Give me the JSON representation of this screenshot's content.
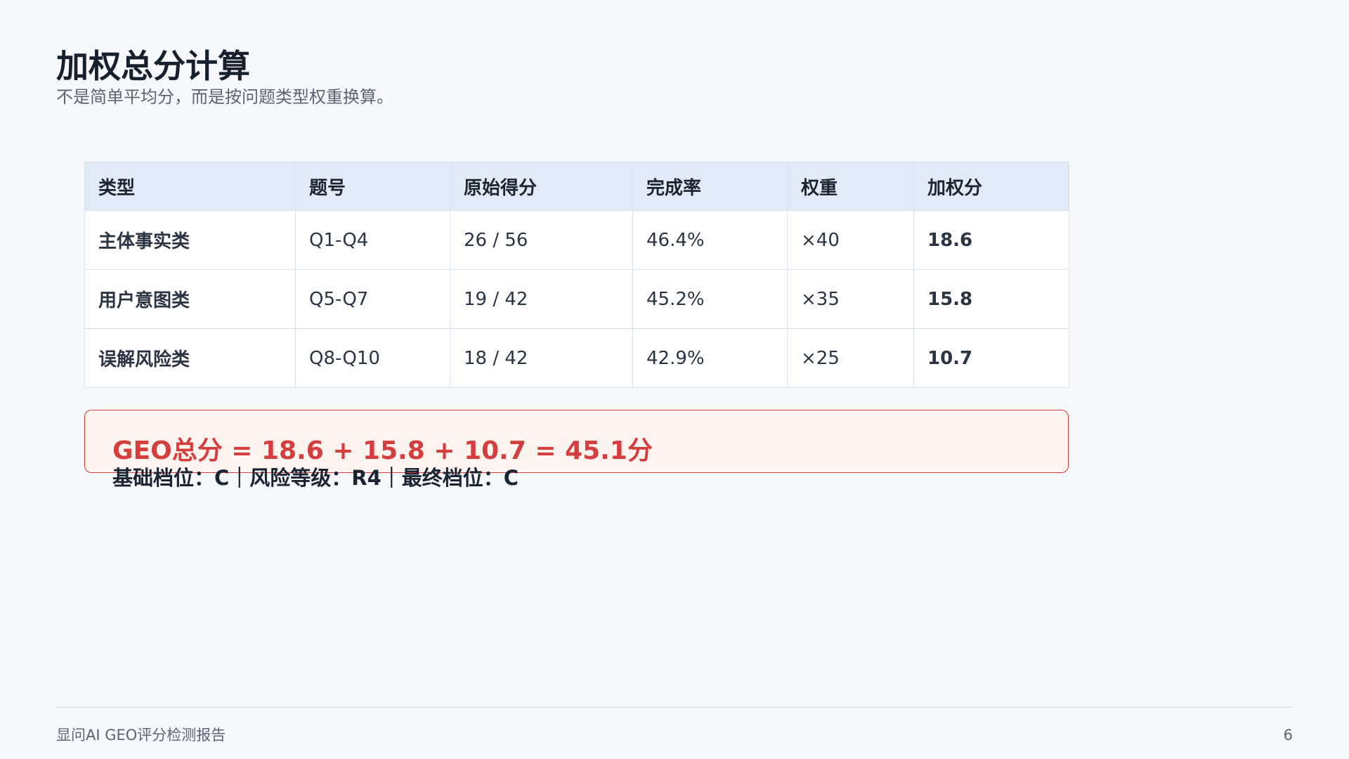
{
  "slide": {
    "title": "加权总分计算",
    "subtitle": "不是简单平均分，而是按问题类型权重换算。"
  },
  "table": {
    "headers": [
      "类型",
      "题号",
      "原始得分",
      "完成率",
      "权重",
      "加权分"
    ],
    "rows": [
      [
        "主体事实类",
        "Q1-Q4",
        "26 / 56",
        "46.4%",
        "×40",
        "18.6"
      ],
      [
        "用户意图类",
        "Q5-Q7",
        "19 / 42",
        "45.2%",
        "×35",
        "15.8"
      ],
      [
        "误解风险类",
        "Q8-Q10",
        "18 / 42",
        "42.9%",
        "×25",
        "10.7"
      ]
    ]
  },
  "summary": {
    "formula": "GEO总分 = 18.6 + 15.8 + 10.7 = 45.1分",
    "grades": "基础档位：C｜风险等级：R4｜最终档位：C"
  },
  "footer": {
    "report_name": "显问AI GEO评分检测报告",
    "page_number": "6"
  },
  "colors": {
    "background": "#f6f8fb",
    "header_fill": "#e1ebf6",
    "weighted_score": "#2862ad",
    "alert_red": "#d43e3e",
    "alert_fill": "#fdf3ef"
  }
}
